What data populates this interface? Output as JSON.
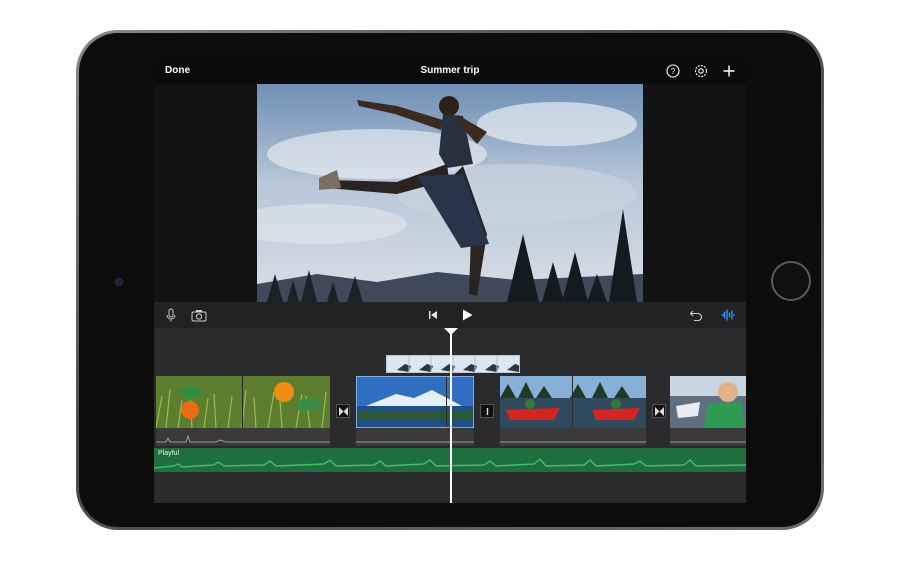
{
  "nav": {
    "done_label": "Done",
    "title": "Summer trip",
    "icons": [
      "help-icon",
      "settings-icon",
      "add-icon"
    ]
  },
  "toolbar": {
    "left_icons": [
      "microphone-icon",
      "camera-icon"
    ],
    "center_icons": [
      "skip-to-start-icon",
      "play-icon"
    ],
    "right_icons": [
      "undo-icon",
      "audio-waveform-icon"
    ]
  },
  "timeline": {
    "music_track_label": "Playful",
    "clips": [
      "kids-in-grass-clip",
      "mountain-lake-clip",
      "red-kayak-clip",
      "child-in-car-clip"
    ],
    "transitions": [
      "cross-dissolve",
      "none",
      "cross-dissolve"
    ]
  },
  "colors": {
    "accent_blue": "#3a9bff",
    "music_green": "#1f6e3d",
    "waveform_green": "#3fbf66"
  }
}
